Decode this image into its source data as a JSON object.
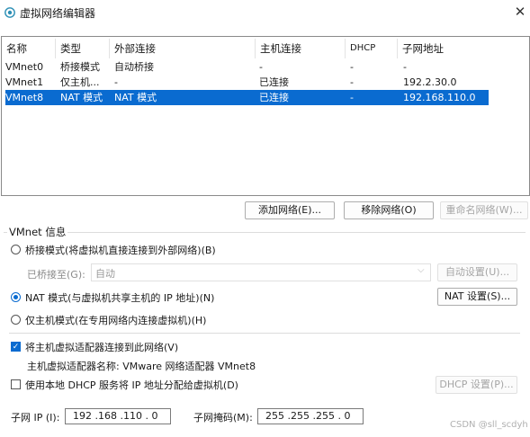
{
  "window": {
    "title": "虚拟网络编辑器",
    "icon": "globe-icon",
    "close": "✕"
  },
  "table": {
    "headers": [
      "名称",
      "类型",
      "外部连接",
      "主机连接",
      "DHCP",
      "子网地址"
    ],
    "rows": [
      [
        "VMnet0",
        "桥接模式",
        "自动桥接",
        "-",
        "-",
        "-"
      ],
      [
        "VMnet1",
        "仅主机...",
        "-",
        "已连接",
        "-",
        "192.2.30.0"
      ],
      [
        "VMnet8",
        "NAT 模式",
        "NAT 模式",
        "已连接",
        "-",
        "192.168.110.0"
      ]
    ],
    "selected_row": 2
  },
  "buttons": {
    "add_network": "添加网络(E)...",
    "remove_network": "移除网络(O)",
    "rename_network": "重命名网络(W)..."
  },
  "vmnet_info": {
    "group_title": "VMnet 信息",
    "bridged_label": "桥接模式(将虚拟机直接连接到外部网络)(B)",
    "bridged_to_label": "已桥接至(G):",
    "bridged_to_value": "自动",
    "auto_settings": "自动设置(U)...",
    "nat_label": "NAT 模式(与虚拟机共享主机的 IP 地址)(N)",
    "nat_settings": "NAT 设置(S)...",
    "hostonly_label": "仅主机模式(在专用网络内连接虚拟机)(H)",
    "selected_mode": "nat",
    "connect_adapter_label": "将主机虚拟适配器连接到此网络(V)",
    "connect_adapter_checked": true,
    "adapter_name_label": "主机虚拟适配器名称: VMware 网络适配器 VMnet8",
    "dhcp_label": "使用本地 DHCP 服务将 IP 地址分配给虚拟机(D)",
    "dhcp_checked": false,
    "dhcp_settings": "DHCP 设置(P)...",
    "subnet_ip_label": "子网 IP (I):",
    "subnet_ip_value": "192 .168 .110 . 0",
    "subnet_mask_label": "子网掩码(M):",
    "subnet_mask_value": "255 .255 .255 . 0"
  },
  "watermark": "CSDN @sll_scdyh",
  "colors": {
    "accent": "#0a6bd0"
  }
}
